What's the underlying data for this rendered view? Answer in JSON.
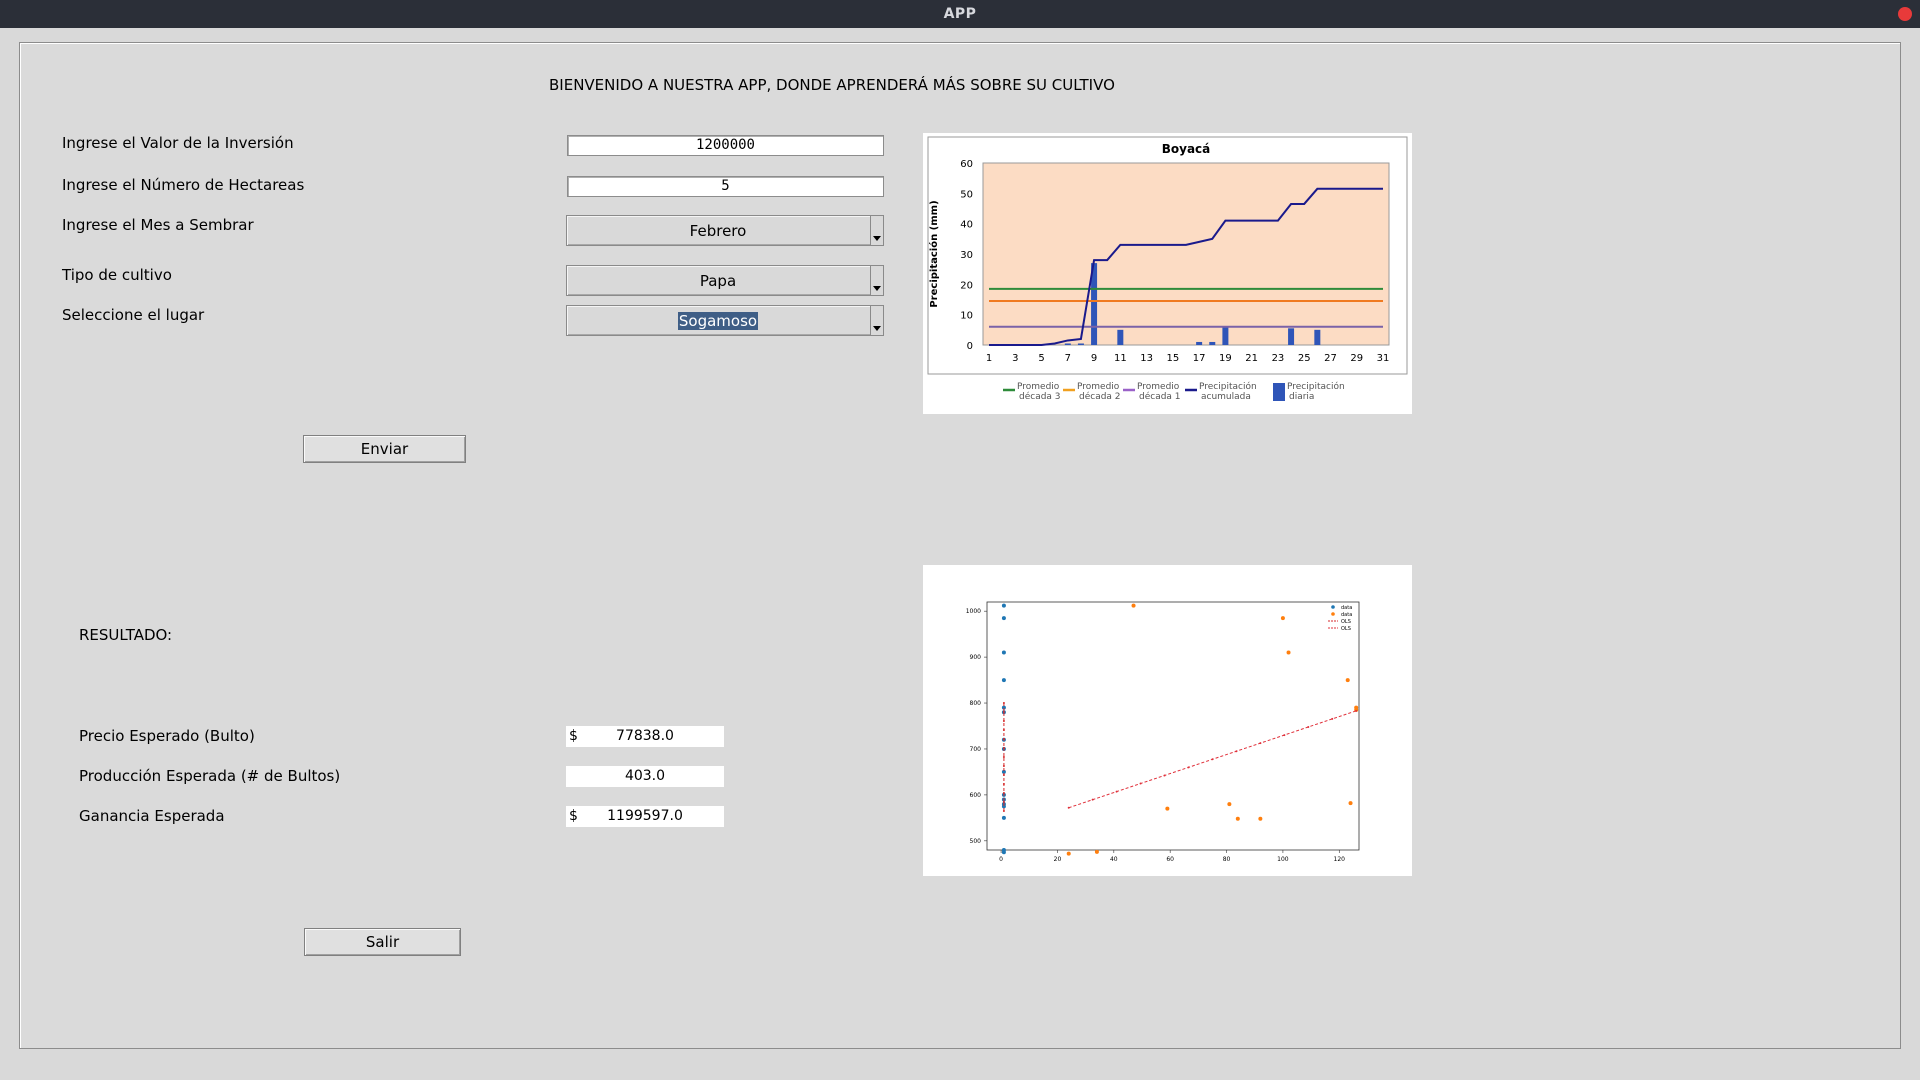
{
  "window": {
    "title": "APP"
  },
  "welcome": "BIENVENIDO A NUESTRA APP, DONDE APRENDERÁ MÁS SOBRE SU CULTIVO",
  "form": {
    "inversion_label": "Ingrese el Valor de la Inversión",
    "inversion_value": "1200000",
    "hectareas_label": "Ingrese el Número de Hectareas",
    "hectareas_value": "5",
    "mes_label": "Ingrese el Mes a Sembrar",
    "mes_value": "Febrero",
    "cultivo_label": "Tipo de cultivo",
    "cultivo_value": "Papa",
    "lugar_label": "Seleccione el lugar",
    "lugar_value": "Sogamoso",
    "enviar_label": "Enviar"
  },
  "results": {
    "header": "RESULTADO:",
    "precio_label": "Precio Esperado (Bulto)",
    "precio_currency": "$",
    "precio_value": "77838.0",
    "produccion_label": "Producción Esperada (# de Bultos)",
    "produccion_value": "403.0",
    "ganancia_label": "Ganancia Esperada",
    "ganancia_currency": "$",
    "ganancia_value": "1199597.0"
  },
  "salir_label": "Salir",
  "colors": {
    "titlebar": "#2b2f38",
    "close": "#e83a3a",
    "selection": "#3f5e86"
  },
  "chart_data": [
    {
      "type": "bar+line",
      "title": "Boyacá",
      "ylabel": "Precipitación (mm)",
      "xlabel": "",
      "ylim": [
        0,
        60
      ],
      "yticks": [
        0,
        10,
        20,
        30,
        40,
        50,
        60
      ],
      "xticks": [
        1,
        3,
        5,
        7,
        9,
        11,
        13,
        15,
        17,
        19,
        21,
        23,
        25,
        27,
        29,
        31
      ],
      "x": [
        1,
        2,
        3,
        4,
        5,
        6,
        7,
        8,
        9,
        10,
        11,
        12,
        13,
        14,
        15,
        16,
        17,
        18,
        19,
        20,
        21,
        22,
        23,
        24,
        25,
        26,
        27,
        28,
        29,
        30,
        31
      ],
      "series": [
        {
          "name": "Precipitación diaria",
          "kind": "bar",
          "color": "#2f55b8",
          "values": [
            0,
            0,
            0,
            0,
            0,
            0,
            0.5,
            0.5,
            27,
            0,
            5,
            0,
            0,
            0,
            0,
            0,
            1,
            1,
            6,
            0,
            0,
            0,
            0,
            5.5,
            0,
            5,
            0,
            0,
            0,
            0,
            0
          ]
        },
        {
          "name": "Precipitación acumulada",
          "kind": "line",
          "color": "#1a1a8c",
          "values": [
            0,
            0,
            0,
            0,
            0,
            0.5,
            1.5,
            2,
            28,
            28,
            33,
            33,
            33,
            33,
            33,
            33,
            34,
            35,
            41,
            41,
            41,
            41,
            41,
            46.5,
            46.5,
            51.5,
            51.5,
            51.5,
            51.5,
            51.5,
            51.5
          ]
        },
        {
          "name": "Promedio década 3",
          "kind": "hline",
          "color": "#2e8b3a",
          "value": 18.5
        },
        {
          "name": "Promedio década 2",
          "kind": "hline",
          "color": "#f07a20",
          "value": 14.5
        },
        {
          "name": "Promedio década 1",
          "kind": "hline",
          "color": "#7a62a8",
          "value": 6
        }
      ],
      "legend": [
        {
          "line1": "Promedio",
          "line2": "década 3",
          "color": "#2e8b3a"
        },
        {
          "line1": "Promedio",
          "line2": "década 2",
          "color": "#f0a020"
        },
        {
          "line1": "Promedio",
          "line2": "década 1",
          "color": "#9a62c8"
        },
        {
          "line1": "Precipitación",
          "line2": "acumulada",
          "color": "#1a1a8c"
        },
        {
          "line1": "Precipitación",
          "line2": "diaria",
          "color": "#2f55b8"
        }
      ],
      "grid": false
    },
    {
      "type": "scatter",
      "title": "",
      "xlabel": "",
      "ylabel": "",
      "xlim": [
        -5,
        127
      ],
      "ylim": [
        480,
        1020
      ],
      "xticks": [
        0,
        20,
        40,
        60,
        80,
        100,
        120
      ],
      "yticks": [
        500,
        600,
        700,
        800,
        900,
        1000
      ],
      "legend_position": "top-right",
      "series": [
        {
          "name": "data",
          "kind": "scatter",
          "color": "#1f77b4",
          "points": [
            [
              1,
              1012
            ],
            [
              1,
              985
            ],
            [
              1,
              910
            ],
            [
              1,
              850
            ],
            [
              1,
              790
            ],
            [
              1,
              780
            ],
            [
              1,
              720
            ],
            [
              1,
              700
            ],
            [
              1,
              650
            ],
            [
              1,
              600
            ],
            [
              1,
              590
            ],
            [
              1,
              580
            ],
            [
              1,
              575
            ],
            [
              1,
              550
            ],
            [
              1,
              480
            ],
            [
              1,
              475
            ]
          ]
        },
        {
          "name": "data",
          "kind": "scatter",
          "color": "#ff7f0e",
          "points": [
            [
              47,
              1012
            ],
            [
              100,
              985
            ],
            [
              102,
              910
            ],
            [
              123,
              850
            ],
            [
              126,
              790
            ],
            [
              126,
              785
            ],
            [
              24,
              472
            ],
            [
              34,
              476
            ],
            [
              59,
              570
            ],
            [
              81,
              580
            ],
            [
              84,
              548
            ],
            [
              92,
              548
            ],
            [
              124,
              582
            ]
          ]
        },
        {
          "name": "OLS",
          "kind": "line",
          "color": "#d62728",
          "points": [
            [
              1,
              565
            ],
            [
              1,
              800
            ]
          ]
        },
        {
          "name": "OLS",
          "kind": "line",
          "color": "#e0303a",
          "points": [
            [
              24,
              572
            ],
            [
              126,
              783
            ]
          ]
        }
      ]
    }
  ]
}
